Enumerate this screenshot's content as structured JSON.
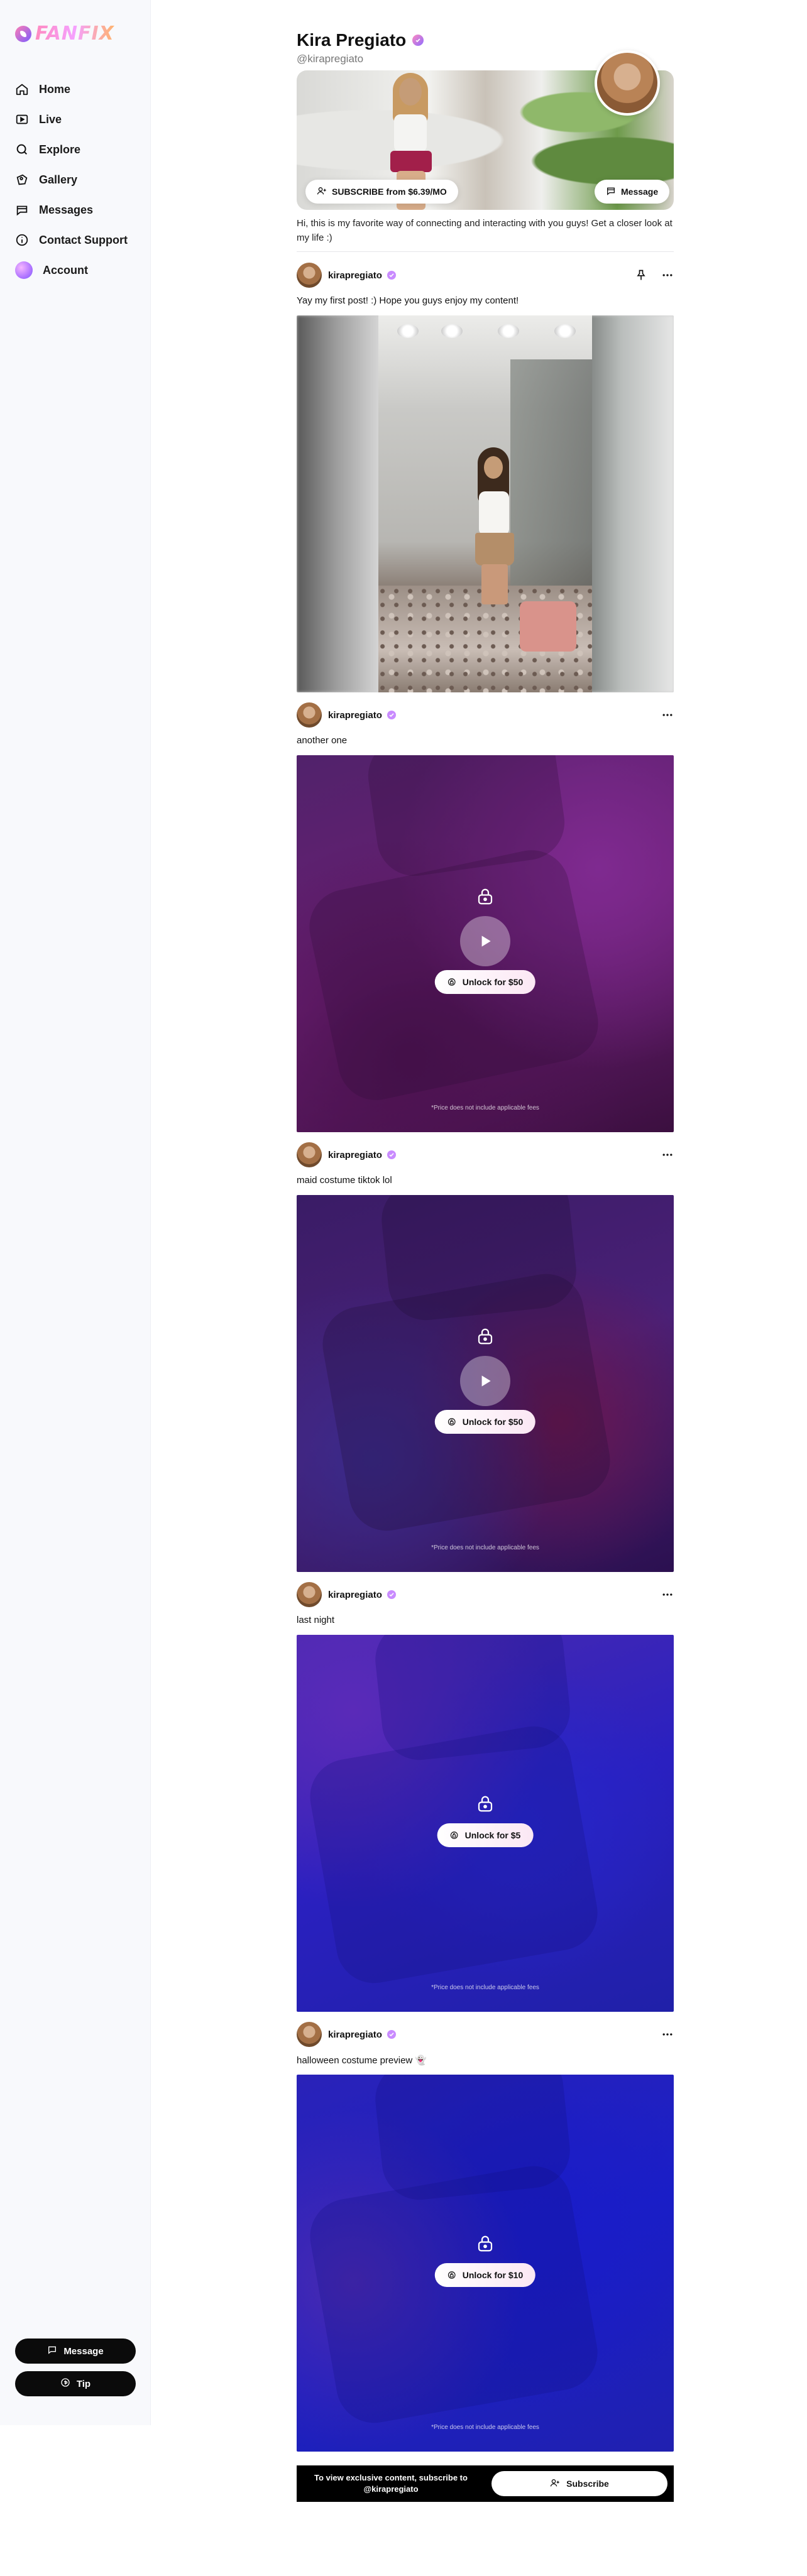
{
  "brand": {
    "logo_text": "FANFIX"
  },
  "sidebar": {
    "items": [
      {
        "label": "Home",
        "icon": "home-icon"
      },
      {
        "label": "Live",
        "icon": "live-icon"
      },
      {
        "label": "Explore",
        "icon": "search-icon"
      },
      {
        "label": "Gallery",
        "icon": "gallery-icon"
      },
      {
        "label": "Messages",
        "icon": "messages-icon"
      },
      {
        "label": "Contact Support",
        "icon": "info-icon"
      },
      {
        "label": "Account",
        "icon": "avatar"
      }
    ],
    "message_label": "Message",
    "tip_label": "Tip"
  },
  "profile": {
    "name": "Kira Pregiato",
    "handle": "@kirapregiato",
    "subscribe_label": "SUBSCRIBE from $6.39/MO",
    "message_label": "Message",
    "bio": "Hi, this is my favorite way of connecting and interacting with you guys! Get a closer look at my life :)"
  },
  "posts": [
    {
      "username": "kirapregiato",
      "caption": "Yay my first post! :) Hope you guys enjoy my content!",
      "type": "photo",
      "pinned": true
    },
    {
      "username": "kirapregiato",
      "caption": "another one",
      "type": "locked-video",
      "unlock_label": "Unlock for $50",
      "fees_note": "*Price does not include applicable fees"
    },
    {
      "username": "kirapregiato",
      "caption": "maid costume tiktok lol",
      "type": "locked-video",
      "unlock_label": "Unlock for $50",
      "fees_note": "*Price does not include applicable fees"
    },
    {
      "username": "kirapregiato",
      "caption": "last night",
      "type": "locked-photo",
      "unlock_label": "Unlock for $5",
      "fees_note": "*Price does not include applicable fees"
    },
    {
      "username": "kirapregiato",
      "caption": "halloween costume preview 👻",
      "type": "locked-photo",
      "unlock_label": "Unlock for $10",
      "fees_note": "*Price does not include applicable fees"
    }
  ],
  "subscribe_bar": {
    "text": "To view exclusive content, subscribe to @kirapregiato",
    "button_label": "Subscribe"
  },
  "colors": {
    "accent_gradient_start": "#ff8ac0",
    "accent_gradient_end": "#8e6bff",
    "post2_bg": "#5a1f6e",
    "post3_bg": "#3e1d63",
    "post4_bg": "#2c1fb8",
    "post5_bg": "#1d22c4"
  }
}
